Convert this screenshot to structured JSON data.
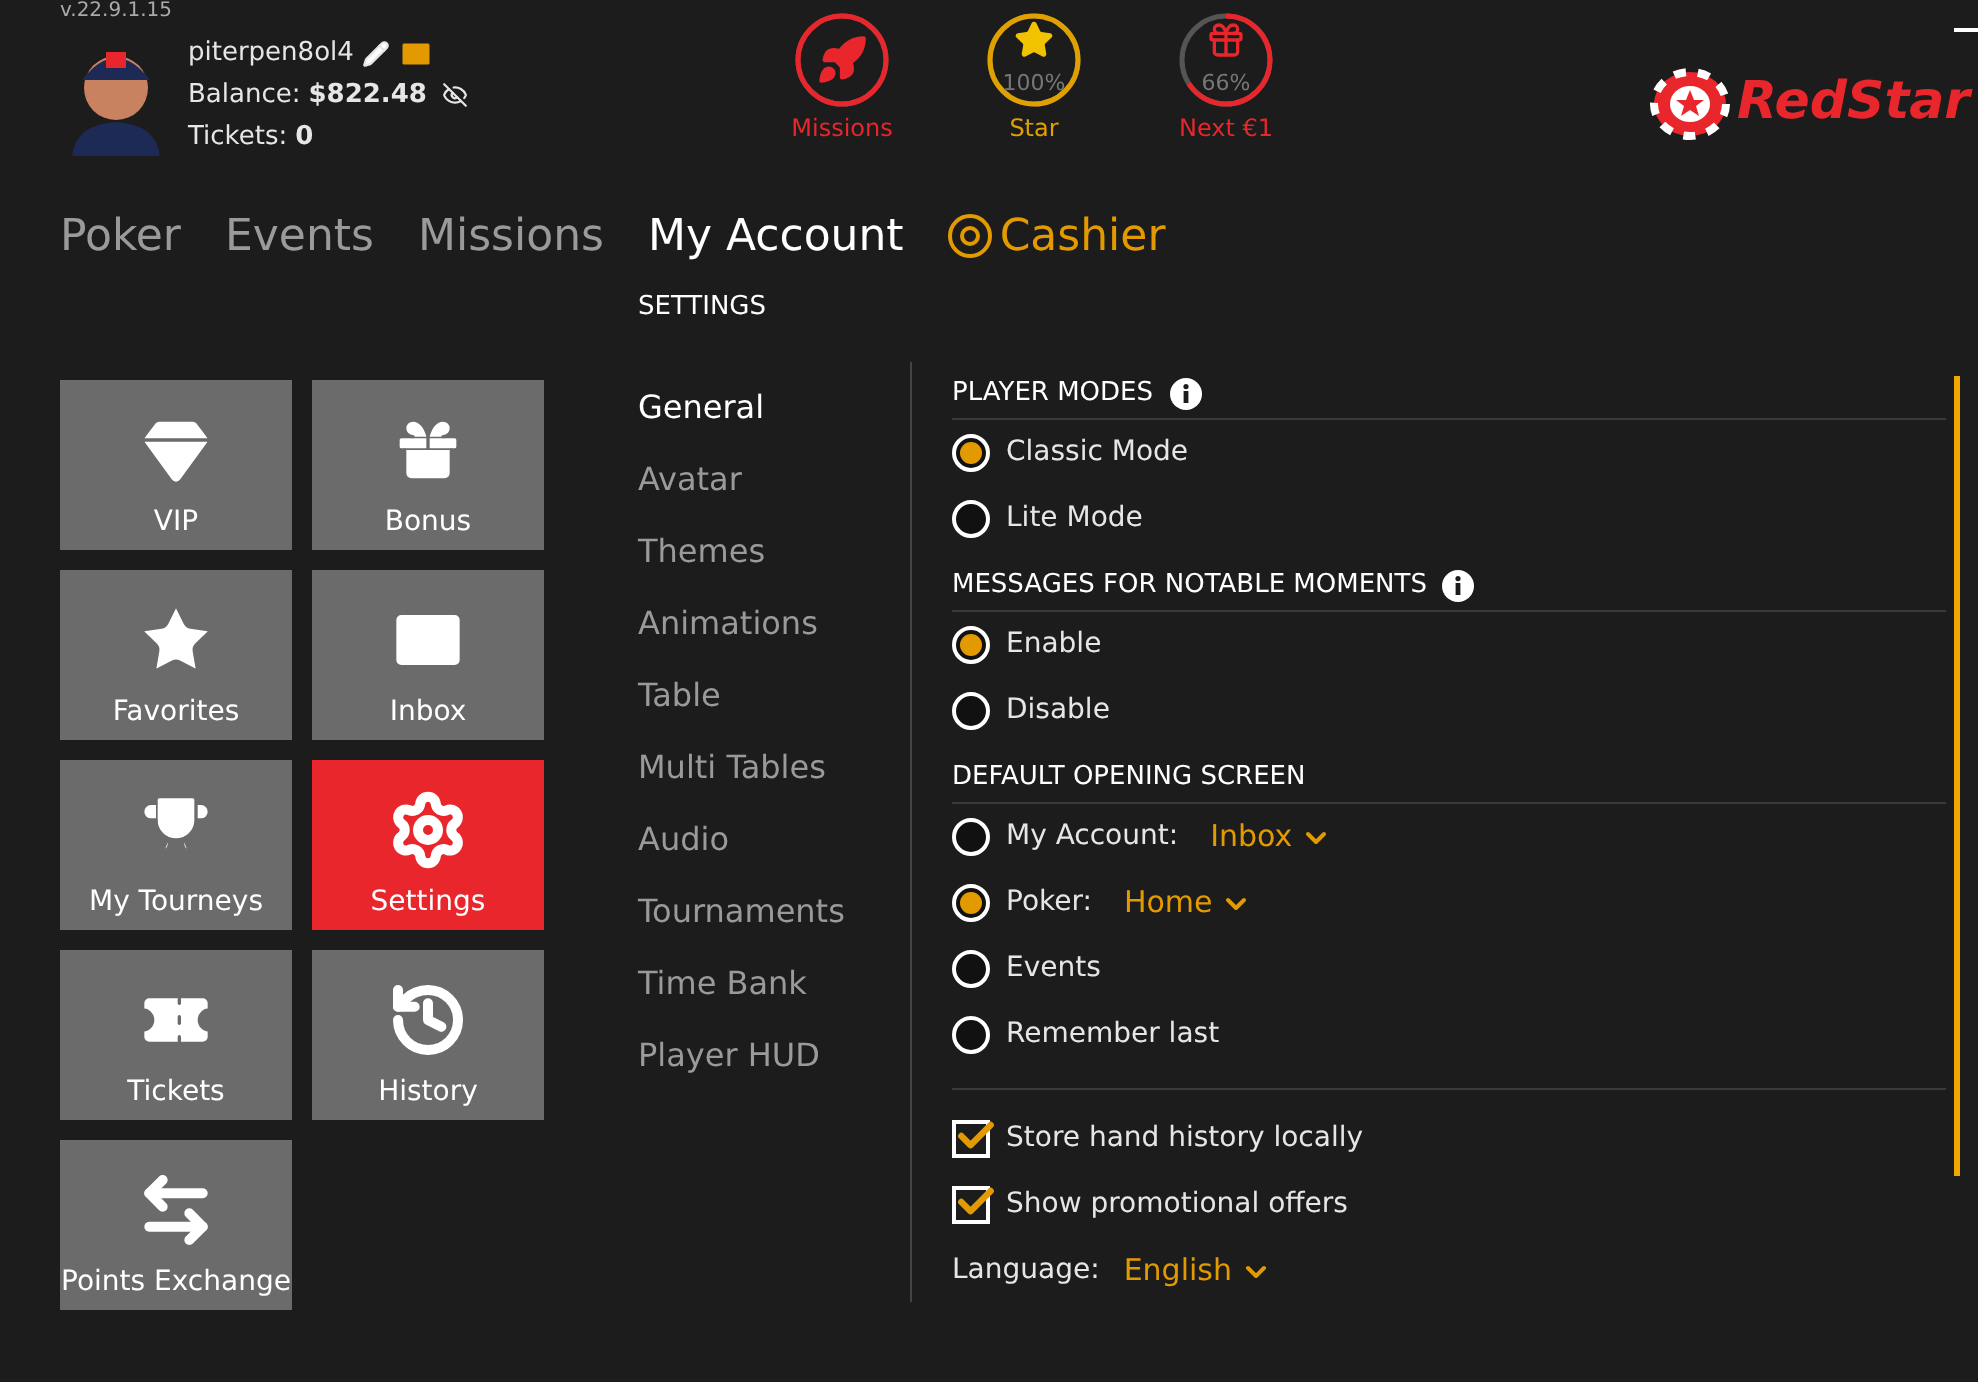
{
  "version": "v.22.9.1.15",
  "profile": {
    "username": "piterpen8ol4",
    "balance_label": "Balance:",
    "balance": "$822.48",
    "tickets_label": "Tickets:",
    "tickets": "0"
  },
  "progress": [
    {
      "kind": "missions",
      "label": "Missions"
    },
    {
      "kind": "star",
      "label": "Star",
      "reading": "100%",
      "level": 1
    },
    {
      "kind": "next",
      "label": "Next €1",
      "reading": "66%",
      "level": 0.66
    }
  ],
  "logo": {
    "text": "RedStar"
  },
  "nav": [
    {
      "label": "Poker",
      "kind": "tab",
      "selected": false
    },
    {
      "label": "Events",
      "kind": "tab",
      "selected": false
    },
    {
      "label": "Missions",
      "kind": "tab",
      "selected": false
    },
    {
      "label": "My Account",
      "kind": "tab",
      "selected": true
    },
    {
      "label": "Cashier",
      "kind": "cashier",
      "selected": false
    }
  ],
  "tiles": [
    {
      "label": "VIP",
      "kind": "vip",
      "selected": false
    },
    {
      "label": "Bonus",
      "kind": "bonus",
      "selected": false
    },
    {
      "label": "Favorites",
      "kind": "favorites",
      "selected": false
    },
    {
      "label": "Inbox",
      "kind": "inbox",
      "selected": false
    },
    {
      "label": "My Tourneys",
      "kind": "tourneys",
      "selected": false
    },
    {
      "label": "Settings",
      "kind": "settings",
      "selected": true
    },
    {
      "label": "Tickets",
      "kind": "tickets",
      "selected": false
    },
    {
      "label": "History",
      "kind": "history",
      "selected": false
    },
    {
      "label": "Points Exchange",
      "kind": "exchange",
      "selected": false
    }
  ],
  "settings": {
    "title": "SETTINGS",
    "menu": [
      {
        "label": "General",
        "selected": true
      },
      {
        "label": "Avatar",
        "selected": false
      },
      {
        "label": "Themes",
        "selected": false
      },
      {
        "label": "Animations",
        "selected": false
      },
      {
        "label": "Table",
        "selected": false
      },
      {
        "label": "Multi Tables",
        "selected": false
      },
      {
        "label": "Audio",
        "selected": false
      },
      {
        "label": "Tournaments",
        "selected": false
      },
      {
        "label": "Time Bank",
        "selected": false
      },
      {
        "label": "Player HUD",
        "selected": false
      }
    ],
    "sections": [
      {
        "title": "PLAYER MODES",
        "info": true,
        "options": [
          {
            "label": "Classic Mode",
            "selected": true
          },
          {
            "label": "Lite Mode",
            "selected": false
          }
        ]
      },
      {
        "title": "MESSAGES FOR NOTABLE MOMENTS",
        "info": true,
        "options": [
          {
            "label": "Enable",
            "selected": true
          },
          {
            "label": "Disable",
            "selected": false
          }
        ]
      },
      {
        "title": "DEFAULT OPENING SCREEN",
        "info": false,
        "options": [
          {
            "label": "My Account:",
            "selected": false,
            "value": "Inbox"
          },
          {
            "label": "Poker:",
            "selected": true,
            "value": "Home"
          },
          {
            "label": "Events",
            "selected": false
          },
          {
            "label": "Remember last",
            "selected": false
          }
        ]
      }
    ],
    "checkboxes": [
      {
        "label": "Store hand history locally",
        "checked": true
      },
      {
        "label": "Show promotional offers",
        "checked": true
      }
    ],
    "language": {
      "label": "Language:",
      "value": "English"
    }
  }
}
